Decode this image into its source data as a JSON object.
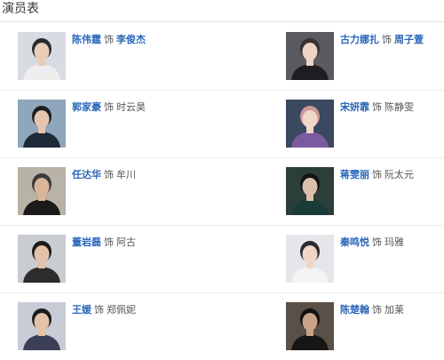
{
  "section_title": "演员表",
  "role_prefix": "饰",
  "cast": [
    {
      "actor": "陈伟霆",
      "role": "李俊杰",
      "role_link": true,
      "avatar_bg": "#d7dbe2",
      "hair": "#2a2a2e",
      "skin": "#e9cdb8",
      "outfit": "#eeeeee"
    },
    {
      "actor": "古力娜扎",
      "role": "周子萱",
      "role_link": true,
      "avatar_bg": "#5a5a60",
      "hair": "#3a3030",
      "skin": "#ecd3c4",
      "outfit": "#1e1e22"
    },
    {
      "actor": "郭家豪",
      "role": "时云昊",
      "role_link": false,
      "avatar_bg": "#8fa6bc",
      "hair": "#1c1c20",
      "skin": "#e5c6ad",
      "outfit": "#1f2a38"
    },
    {
      "actor": "宋妍霏",
      "role": "陈静雯",
      "role_link": false,
      "avatar_bg": "#3a4860",
      "hair": "#c89a96",
      "skin": "#f1d7c8",
      "outfit": "#7b5aa0"
    },
    {
      "actor": "任达华",
      "role": "牟川",
      "role_link": false,
      "avatar_bg": "#b9b2a6",
      "hair": "#3a3a3a",
      "skin": "#d9b59a",
      "outfit": "#1a1a1a"
    },
    {
      "actor": "蒋雯丽",
      "role": "阮太元",
      "role_link": false,
      "avatar_bg": "#2c3e3a",
      "hair": "#141414",
      "skin": "#dcbfa8",
      "outfit": "#1b3b38"
    },
    {
      "actor": "董岩磊",
      "role": "阿古",
      "role_link": false,
      "avatar_bg": "#c9ccd1",
      "hair": "#1a1a1a",
      "skin": "#e2c2a8",
      "outfit": "#2c2c2c"
    },
    {
      "actor": "秦鸣悦",
      "role": "玛雅",
      "role_link": false,
      "avatar_bg": "#e6e6ea",
      "hair": "#2b2b2f",
      "skin": "#f0d6c6",
      "outfit": "#f4f4f4"
    },
    {
      "actor": "王媛",
      "role": "郑佩妮",
      "role_link": false,
      "avatar_bg": "#c7ccd6",
      "hair": "#1b1b1d",
      "skin": "#e4c2a6",
      "outfit": "#3a3f55"
    },
    {
      "actor": "陈楚翰",
      "role": "加莱",
      "role_link": false,
      "avatar_bg": "#5a5048",
      "hair": "#121212",
      "skin": "#caa286",
      "outfit": "#161616"
    }
  ]
}
